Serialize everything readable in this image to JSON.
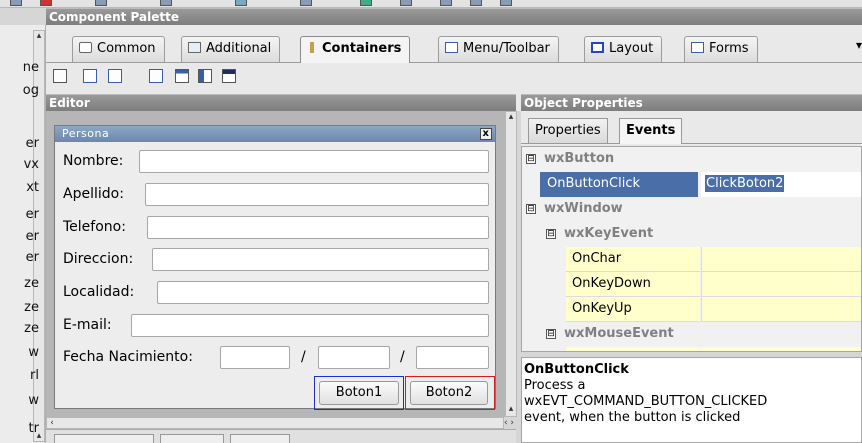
{
  "palette": {
    "header": "Component Palette",
    "tabs": [
      {
        "label": "Common",
        "icon": "common-icon"
      },
      {
        "label": "Additional",
        "icon": "additional-icon"
      },
      {
        "label": "Containers",
        "icon": "containers-icon",
        "active": true
      },
      {
        "label": "Menu/Toolbar",
        "icon": "menu-toolbar-icon"
      },
      {
        "label": "Layout",
        "icon": "layout-icon"
      },
      {
        "label": "Forms",
        "icon": "forms-icon"
      }
    ]
  },
  "left_strip_letters": [
    "ne",
    "og",
    "er",
    "vx",
    "xt",
    "er",
    "er",
    "er",
    "ze",
    "ze",
    "ze",
    "w",
    "rl",
    "w",
    "tr"
  ],
  "editor": {
    "header": "Editor",
    "form": {
      "title": "Persona",
      "close": "x",
      "fields": [
        {
          "label": "Nombre:"
        },
        {
          "label": "Apellido:"
        },
        {
          "label": "Telefono:"
        },
        {
          "label": "Direccion:"
        },
        {
          "label": "Localidad:"
        },
        {
          "label": "E-mail:"
        }
      ],
      "birth_label": "Fecha Nacimiento:",
      "separator": "/",
      "buttons": [
        {
          "label": "Boton1",
          "outline": "#1c2fd0"
        },
        {
          "label": "Boton2",
          "outline": "#d81c1c"
        }
      ]
    }
  },
  "properties": {
    "header": "Object Properties",
    "tabs": [
      {
        "label": "Properties"
      },
      {
        "label": "Events",
        "active": true
      }
    ],
    "groups": {
      "wxButton": "wxButton",
      "wxWindow": "wxWindow",
      "wxKeyEvent": "wxKeyEvent",
      "wxMouseEvent": "wxMouseEvent"
    },
    "events": {
      "onbuttonclick": {
        "name": "OnButtonClick",
        "value": "ClickBoton2"
      },
      "onchar": {
        "name": "OnChar",
        "value": ""
      },
      "onkeydown": {
        "name": "OnKeyDown",
        "value": ""
      },
      "onkeyup": {
        "name": "OnKeyUp",
        "value": ""
      }
    },
    "collapse_symbol": "⊟"
  },
  "help": {
    "title": "OnButtonClick",
    "line1": "Process a",
    "line2": "wxEVT_COMMAND_BUTTON_CLICKED",
    "line3": "event, when the button is clicked"
  },
  "colors": {
    "selection": "#4a6ea8",
    "event_row_bg": "#ffffcc",
    "boton1_outline": "#1c2fd0",
    "boton2_outline": "#d81c1c"
  }
}
